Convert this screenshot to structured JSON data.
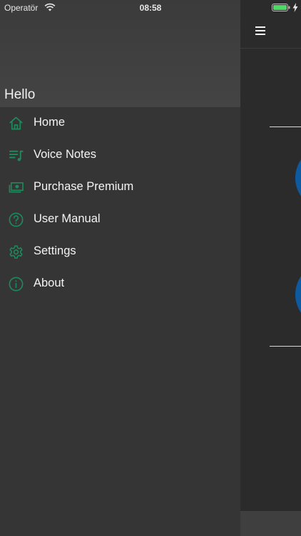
{
  "status_bar": {
    "carrier": "Operatör",
    "time": "08:58",
    "wifi_icon": "wifi-icon",
    "battery_icon": "battery-charging-icon",
    "battery_color": "#4cd964"
  },
  "drawer": {
    "greeting": "Hello",
    "accent_color": "#1e8a5c",
    "menu_items": [
      {
        "label": "Home",
        "icon": "home-icon"
      },
      {
        "label": "Voice Notes",
        "icon": "playlist-music-icon"
      },
      {
        "label": "Purchase Premium",
        "icon": "money-icon"
      },
      {
        "label": "User Manual",
        "icon": "help-circle-icon"
      },
      {
        "label": "Settings",
        "icon": "gear-icon"
      },
      {
        "label": "About",
        "icon": "info-circle-icon"
      }
    ]
  },
  "main": {
    "menu_icon": "hamburger-menu-icon",
    "button_color": "#0e5aa0"
  }
}
